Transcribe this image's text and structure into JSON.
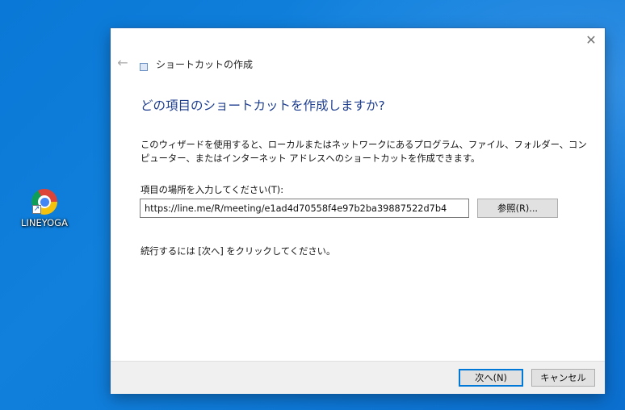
{
  "desktop": {
    "icon_label": "LINEYOGA",
    "icon_name": "chrome-shortcut-icon"
  },
  "dialog": {
    "close_glyph": "✕",
    "back_glyph": "←",
    "title": "ショートカットの作成",
    "heading": "どの項目のショートカットを作成しますか?",
    "description": "このウィザードを使用すると、ローカルまたはネットワークにあるプログラム、ファイル、フォルダー、コンピューター、またはインターネット アドレスへのショートカットを作成できます。",
    "location_label": "項目の場所を入力してください(T):",
    "location_value": "https://line.me/R/meeting/e1ad4d70558f4e97b2ba39887522d7b4",
    "browse_label": "参照(R)...",
    "continue_text": "続行するには [次へ] をクリックしてください。",
    "next_label": "次へ(N)",
    "cancel_label": "キャンセル"
  },
  "colors": {
    "desktop_bg": "#0a78d6",
    "heading": "#1d3d8e",
    "default_button_border": "#0078d7"
  }
}
